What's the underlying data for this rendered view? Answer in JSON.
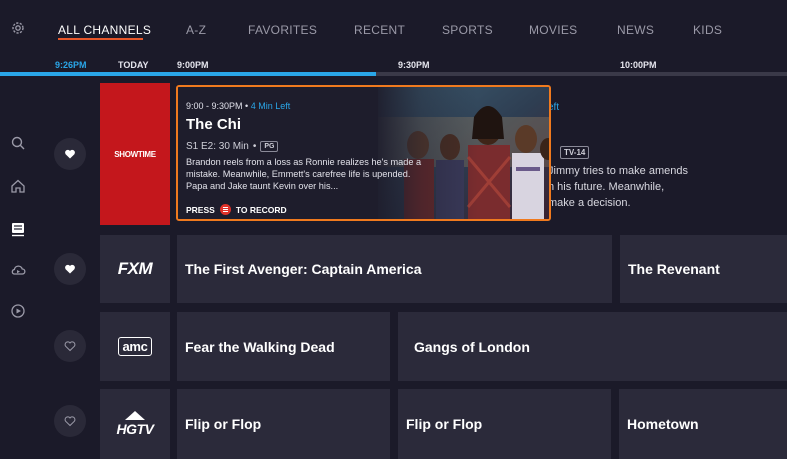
{
  "nav": {
    "tabs": [
      {
        "label": "ALL CHANNELS",
        "active": true
      },
      {
        "label": "A-Z"
      },
      {
        "label": "FAVORITES"
      },
      {
        "label": "RECENT"
      },
      {
        "label": "SPORTS"
      },
      {
        "label": "MOVIES"
      },
      {
        "label": "NEWS"
      },
      {
        "label": "KIDS"
      }
    ]
  },
  "sidebar": {
    "icons": [
      "settings-icon",
      "search-icon",
      "home-icon",
      "guide-icon",
      "cloud-dvr-icon",
      "play-icon"
    ]
  },
  "timeline": {
    "now": "9:26PM",
    "today": "TODAY",
    "slots": [
      "9:00PM",
      "9:30PM",
      "10:00PM"
    ],
    "progress_fraction": 0.478
  },
  "channels": [
    {
      "logo": "SHOWTIME",
      "favorite": true,
      "background_desc": {
        "left_text": "eft",
        "rating": "TV-14",
        "line1": "Jimmy tries to make amends",
        "line2": "n his future. Meanwhile,",
        "line3": "make a decision."
      }
    },
    {
      "logo": "FXM",
      "favorite": true,
      "programs": [
        "The First Avenger: Captain America",
        "The Revenant"
      ]
    },
    {
      "logo": "amc",
      "favorite": false,
      "programs": [
        "Fear the Walking Dead",
        "Gangs of London"
      ]
    },
    {
      "logo": "HGTV",
      "favorite": false,
      "programs": [
        "Flip or Flop",
        "Flip or Flop",
        "Hometown"
      ]
    }
  ],
  "card": {
    "time": "9:00 - 9:30PM",
    "time_left": "4 Min Left",
    "title": "The Chi",
    "meta": "S1 E2: 30 Min",
    "rating": "PG",
    "description": "Brandon reels from a loss as Ronnie realizes he's made a mistake. Meanwhile, Emmett's carefree life is upended. Papa and Jake taunt Kevin over his...",
    "record_prefix": "PRESS",
    "record_suffix": "TO RECORD"
  },
  "colors": {
    "background": "#1b1a29",
    "tile": "#2b2a3a",
    "accent_orange": "#f07a1e",
    "accent_blue": "#2aa6e8",
    "showtime_red": "#c4171c"
  }
}
